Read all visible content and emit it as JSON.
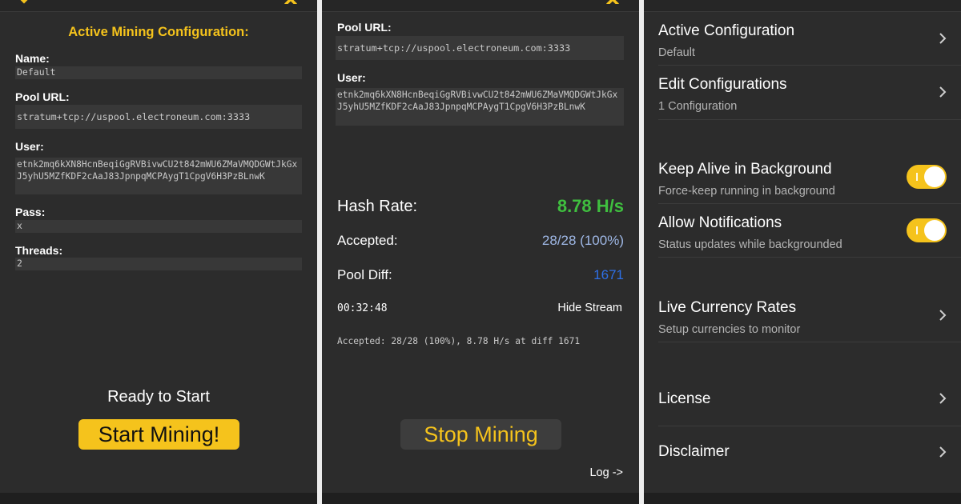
{
  "colors": {
    "accent": "#f5c31c",
    "hash_rate": "#3fbf3f",
    "accepted": "#9fb8e6",
    "pool_diff": "#2e6fe6",
    "background": "#2c2c2c"
  },
  "config_screen": {
    "heading": "Active Mining Configuration:",
    "name_label": "Name:",
    "name_value": "Default",
    "pool_label": "Pool URL:",
    "pool_value": "stratum+tcp://uspool.electroneum.com:3333",
    "user_label": "User:",
    "user_value": "etnk2mq6kXN8HcnBeqiGgRVBivwCU2t842mWU6ZMaVMQDGWtJkGxJ5yhU5MZfKDF2cAaJ83JpnpqMCPAygT1CpgV6H3PzBLnwK",
    "pass_label": "Pass:",
    "pass_value": "x",
    "threads_label": "Threads:",
    "threads_value": "2",
    "status": "Ready to Start",
    "start_button": "Start Mining!"
  },
  "mining_screen": {
    "pool_label": "Pool URL:",
    "pool_value": "stratum+tcp://uspool.electroneum.com:3333",
    "user_label": "User:",
    "user_value": "etnk2mq6kXN8HcnBeqiGgRVBivwCU2t842mWU6ZMaVMQDGWtJkGxJ5yhU5MZfKDF2cAaJ83JpnpqMCPAygT1CpgV6H3PzBLnwK",
    "hash_rate_label": "Hash Rate:",
    "hash_rate_value": "8.78 H/s",
    "accepted_label": "Accepted:",
    "accepted_value": "28/28 (100%)",
    "pool_diff_label": "Pool Diff:",
    "pool_diff_value": "1671",
    "elapsed": "00:32:48",
    "hide_stream": "Hide Stream",
    "stream_line": "Accepted: 28/28 (100%), 8.78 H/s at diff 1671",
    "stop_button": "Stop Mining",
    "log_link": "Log ->"
  },
  "settings_screen": {
    "rows": [
      {
        "title": "Active Configuration",
        "subtitle": "Default"
      },
      {
        "title": "Edit Configurations",
        "subtitle": "1 Configuration"
      },
      {
        "title": "Keep Alive in Background",
        "subtitle": "Force-keep running in background",
        "toggle": true
      },
      {
        "title": "Allow Notifications",
        "subtitle": "Status updates while backgrounded",
        "toggle": true
      },
      {
        "title": "Live Currency Rates",
        "subtitle": "Setup currencies to monitor"
      },
      {
        "title": "License"
      },
      {
        "title": "Disclaimer"
      }
    ]
  },
  "icons": [
    "chevron-down-icon",
    "close-icon",
    "chevron-right-icon",
    "toggle-switch"
  ]
}
